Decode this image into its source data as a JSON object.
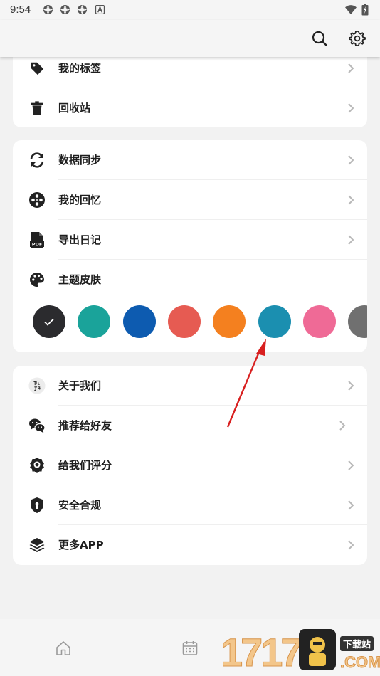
{
  "status_bar": {
    "time": "9:54",
    "icons": [
      "app-notification-icon",
      "app-notification-icon",
      "app-notification-icon",
      "a-notification-icon",
      "wifi-icon",
      "battery-icon"
    ]
  },
  "toolbar": {
    "icons": [
      "search-icon",
      "settings-gear-icon"
    ]
  },
  "group1": {
    "items": [
      {
        "label": "我的标签",
        "icon": "tag-icon"
      },
      {
        "label": "回收站",
        "icon": "trash-icon"
      }
    ]
  },
  "group2": {
    "items": [
      {
        "label": "数据同步",
        "icon": "sync-icon"
      },
      {
        "label": "我的回忆",
        "icon": "film-reel-icon"
      },
      {
        "label": "导出日记",
        "icon": "pdf-file-icon"
      },
      {
        "label": "主题皮肤",
        "icon": "palette-icon"
      }
    ],
    "theme_colors": [
      "#2b2b2e",
      "#1aa39a",
      "#0d5bb0",
      "#e65b52",
      "#f4801f",
      "#1b8fb0",
      "#ef6a96",
      "#707070"
    ],
    "selected_theme_index": 0
  },
  "group3": {
    "items": [
      {
        "label": "关于我们",
        "icon": "app-logo-icon"
      },
      {
        "label": "推荐给好友",
        "icon": "wechat-icon"
      },
      {
        "label": "给我们评分",
        "icon": "rating-badge-icon"
      },
      {
        "label": "安全合规",
        "icon": "shield-icon"
      },
      {
        "label": "更多APP",
        "icon": "layers-icon"
      }
    ]
  },
  "bottom_nav": {
    "icons": [
      "home-icon",
      "calendar-icon"
    ]
  },
  "watermark": {
    "digits": "17178",
    "badge": "下载站",
    "domain": ".COM"
  }
}
